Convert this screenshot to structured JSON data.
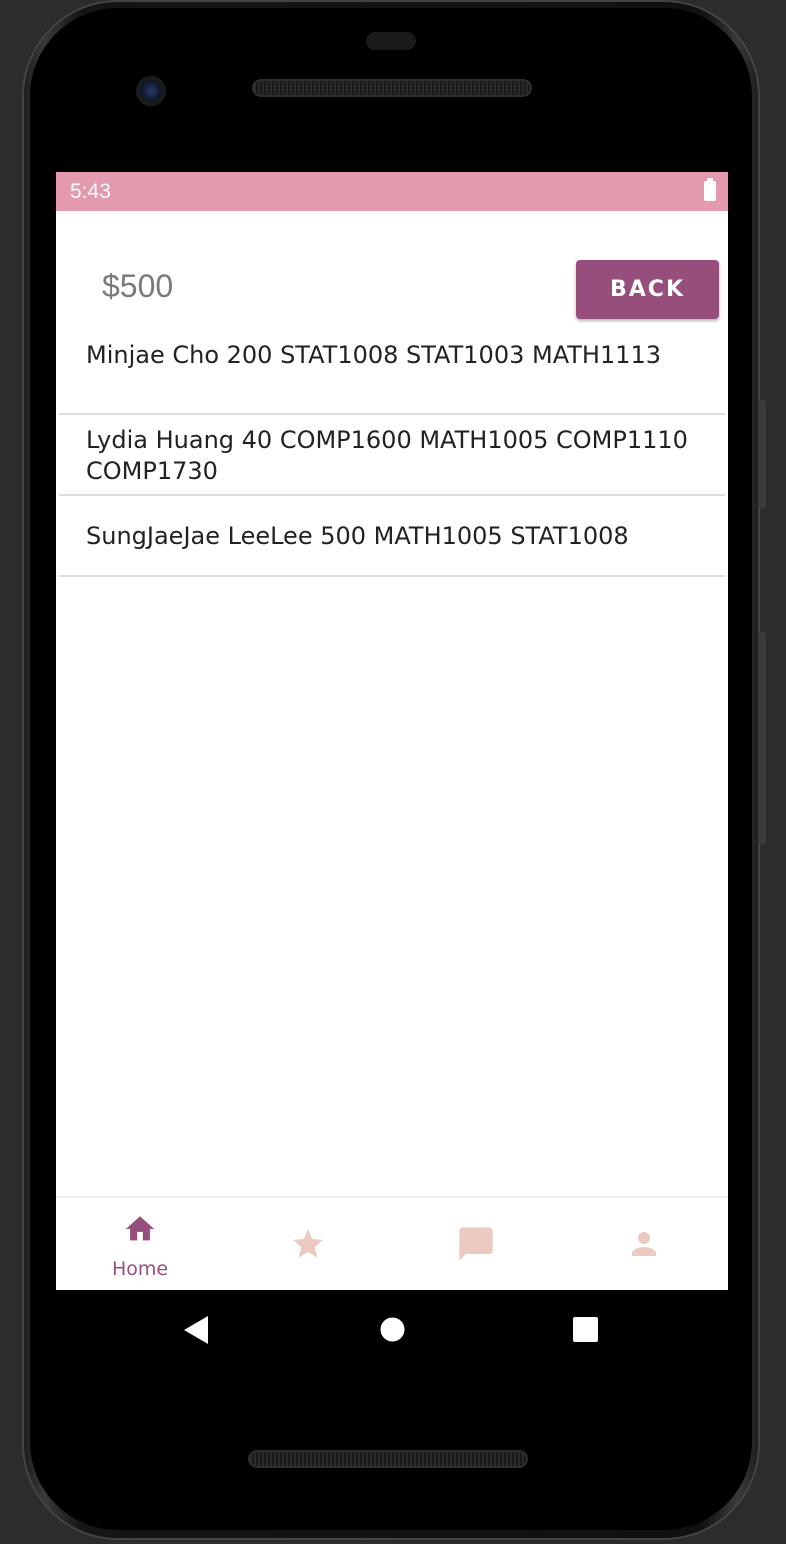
{
  "status_bar": {
    "time": "5:43"
  },
  "header": {
    "balance": "$500",
    "back_label": "BACK"
  },
  "list": {
    "items": [
      "Minjae Cho 200 STAT1008  STAT1003  MATH1113",
      "Lydia Huang 40 COMP1600  MATH1005  COMP1110  COMP1730",
      "SungJaeJae LeeLee 500 MATH1005  STAT1008"
    ]
  },
  "bottom_nav": {
    "items": [
      {
        "icon": "home-icon",
        "label": "Home",
        "active": true
      },
      {
        "icon": "star-icon",
        "label": "",
        "active": false
      },
      {
        "icon": "chat-icon",
        "label": "",
        "active": false
      },
      {
        "icon": "person-icon",
        "label": "",
        "active": false
      }
    ]
  },
  "colors": {
    "status_bar": "#e39aae",
    "accent": "#964f7c",
    "inactive_icon": "#ecc9c1"
  }
}
